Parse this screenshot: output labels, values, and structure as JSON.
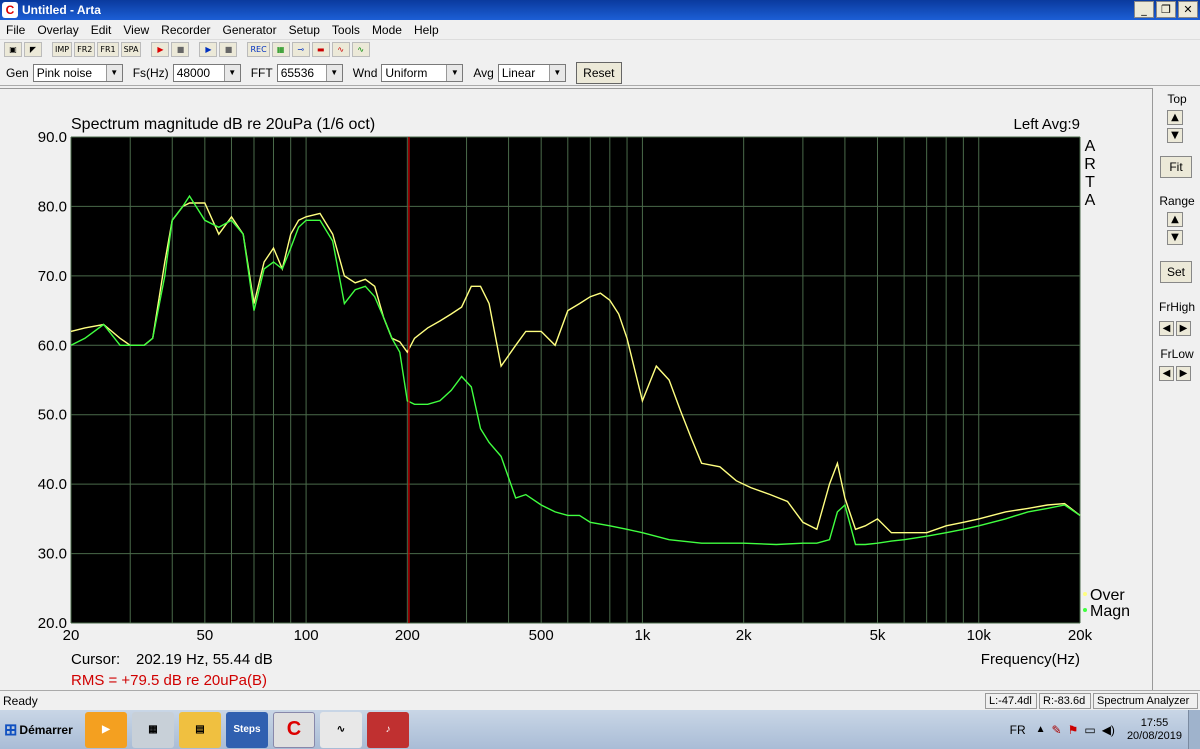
{
  "window": {
    "title": "Untitled - Arta",
    "icon": "arta-icon",
    "controls": [
      "_",
      "❐",
      "✕"
    ]
  },
  "menu": [
    "File",
    "Overlay",
    "Edit",
    "View",
    "Recorder",
    "Generator",
    "Setup",
    "Tools",
    "Mode",
    "Help"
  ],
  "toolbar": {
    "buttons": [
      {
        "name": "open-icon",
        "glyph": "▣"
      },
      {
        "name": "arrow-icon",
        "glyph": "◤"
      },
      {
        "name": "imp-button",
        "glyph": "IMP"
      },
      {
        "name": "fr2-button",
        "glyph": "FR2"
      },
      {
        "name": "fr1-button",
        "glyph": "FR1"
      },
      {
        "name": "spa-button",
        "glyph": "SPA"
      },
      {
        "name": "record-icon",
        "glyph": "▶"
      },
      {
        "name": "stop-icon",
        "glyph": "■"
      },
      {
        "name": "play-icon",
        "glyph": "▶"
      },
      {
        "name": "stop2-icon",
        "glyph": "■"
      },
      {
        "name": "rec-icon",
        "glyph": "REC"
      },
      {
        "name": "grid-icon",
        "glyph": "▦"
      },
      {
        "name": "probe-icon",
        "glyph": "⊸"
      },
      {
        "name": "colors-icon",
        "glyph": "▬"
      },
      {
        "name": "wave-icon",
        "glyph": "∿"
      },
      {
        "name": "scope-icon",
        "glyph": "∿"
      }
    ]
  },
  "generator_bar": {
    "gen_label": "Gen",
    "gen_value": "Pink noise",
    "fs_label": "Fs(Hz)",
    "fs_value": "48000",
    "fft_label": "FFT",
    "fft_value": "65536",
    "wnd_label": "Wnd",
    "wnd_value": "Uniform",
    "avg_label": "Avg",
    "avg_value": "Linear",
    "reset_label": "Reset"
  },
  "right_panel": {
    "top_label": "Top",
    "fit_label": "Fit",
    "range_label": "Range",
    "set_label": "Set",
    "frhigh_label": "FrHigh",
    "frlow_label": "FrLow"
  },
  "plot_info": {
    "cursor_label": "Cursor:",
    "cursor_value": "202.19 Hz, 55.44 dB",
    "rms_text": "RMS =  +79.5 dB re 20uPa(B)",
    "channel": "Left  Avg:9",
    "side_logo": [
      "A",
      "R",
      "T",
      "A"
    ]
  },
  "status": {
    "left": "Ready",
    "l_level": "L:-47.4dl",
    "r_level": "R:-83.6d",
    "mode": "Spectrum Analyzer"
  },
  "taskbar": {
    "start_label": "Démarrer",
    "apps": [
      {
        "name": "media-player-icon",
        "label": "",
        "bg": "#f4a020"
      },
      {
        "name": "calculator-icon",
        "label": "",
        "bg": "#c8d0d8"
      },
      {
        "name": "explorer-icon",
        "label": "",
        "bg": "#f0c040"
      },
      {
        "name": "steps-icon",
        "label": "Steps",
        "bg": "#3060b0"
      },
      {
        "name": "arta-task-icon",
        "label": "",
        "bg": "#e0e0e0"
      },
      {
        "name": "scope-task-icon",
        "label": "",
        "bg": "#e8e8e8"
      },
      {
        "name": "dj-icon",
        "label": "",
        "bg": "#c03030"
      }
    ],
    "lang": "FR",
    "time": "17:55",
    "date": "20/08/2019"
  },
  "colors": {
    "plot_bg": "#000000",
    "grid": "#4a6a4a",
    "overlay": "#ffff80",
    "magn": "#40ff40",
    "cursor": "#b00000",
    "rms": "#d00000"
  },
  "chart_data": {
    "type": "line",
    "title": "Spectrum magnitude dB re 20uPa (1/6 oct)",
    "xlabel": "Frequency(Hz)",
    "ylabel": "",
    "xscale": "log",
    "xlim": [
      20,
      20000
    ],
    "ylim": [
      20,
      90
    ],
    "x_ticks": [
      20,
      50,
      100,
      200,
      500,
      1000,
      2000,
      5000,
      10000,
      20000
    ],
    "x_tick_labels": [
      "20",
      "50",
      "100",
      "200",
      "500",
      "1k",
      "2k",
      "5k",
      "10k",
      "20k"
    ],
    "y_ticks": [
      20,
      30,
      40,
      50,
      60,
      70,
      80,
      90
    ],
    "y_tick_labels": [
      "20.0",
      "30.0",
      "40.0",
      "50.0",
      "60.0",
      "70.0",
      "80.0",
      "90.0"
    ],
    "cursor_x": 202.19,
    "legend": "bottom-right",
    "series": [
      {
        "name": "Over",
        "x": [
          20,
          22,
          25,
          28,
          30,
          33,
          35,
          38,
          40,
          43,
          45,
          50,
          55,
          60,
          65,
          70,
          75,
          80,
          85,
          90,
          95,
          100,
          110,
          120,
          130,
          140,
          150,
          160,
          170,
          180,
          190,
          200,
          210,
          230,
          250,
          270,
          290,
          310,
          330,
          350,
          380,
          420,
          450,
          500,
          550,
          600,
          650,
          700,
          750,
          800,
          850,
          900,
          1000,
          1100,
          1200,
          1300,
          1400,
          1500,
          1700,
          1900,
          2100,
          2400,
          2700,
          3000,
          3300,
          3600,
          3800,
          4000,
          4300,
          4600,
          5000,
          5500,
          6000,
          7000,
          8000,
          9000,
          10000,
          12000,
          14000,
          16000,
          18000,
          20000
        ],
        "y": [
          62,
          62.5,
          63,
          61,
          60,
          60,
          61,
          72,
          78,
          80,
          80.5,
          80.5,
          76,
          78.5,
          76,
          66,
          72,
          74,
          71,
          76,
          78,
          78.5,
          79,
          76,
          70,
          69,
          69.5,
          68.5,
          64,
          61,
          60.5,
          59,
          61,
          62.5,
          63.5,
          64.5,
          65.5,
          68.5,
          68.5,
          66,
          57,
          60,
          62,
          62,
          60,
          65,
          66,
          67,
          67.5,
          66.5,
          64.5,
          61,
          52,
          57,
          55,
          50.5,
          46.5,
          43,
          42.5,
          40.5,
          39.5,
          38.5,
          37.5,
          34.5,
          33.5,
          40,
          43,
          38,
          33.5,
          34,
          35,
          33,
          33,
          33,
          34,
          34.5,
          35,
          36,
          36.5,
          37,
          37.2,
          35.5
        ]
      },
      {
        "name": "Magn",
        "x": [
          20,
          22,
          25,
          28,
          30,
          33,
          35,
          38,
          40,
          43,
          45,
          50,
          55,
          60,
          65,
          70,
          75,
          80,
          85,
          90,
          95,
          100,
          110,
          120,
          130,
          140,
          150,
          160,
          170,
          180,
          190,
          200,
          210,
          230,
          250,
          270,
          290,
          310,
          330,
          350,
          380,
          420,
          450,
          500,
          550,
          600,
          650,
          700,
          800,
          900,
          1000,
          1200,
          1500,
          2000,
          2500,
          3000,
          3300,
          3600,
          3800,
          4000,
          4300,
          4600,
          5000,
          5500,
          6000,
          7000,
          8000,
          9000,
          10000,
          12000,
          14000,
          16000,
          18000,
          20000
        ],
        "y": [
          60,
          61,
          63,
          60,
          60,
          60,
          61,
          70,
          78,
          80,
          81.5,
          78,
          77,
          78,
          76,
          65,
          71,
          72,
          71,
          74,
          77,
          78,
          78,
          75,
          66,
          68,
          68.5,
          67,
          64,
          61,
          59,
          52,
          51.5,
          51.5,
          52,
          53.5,
          55.5,
          54,
          48,
          46,
          44,
          38,
          38.5,
          37,
          36,
          35.5,
          35.5,
          34.5,
          34,
          33.5,
          33,
          32,
          31.5,
          31.5,
          31.3,
          31.5,
          31.5,
          32,
          36,
          37,
          31.3,
          31.3,
          31.5,
          31.8,
          32,
          32.5,
          33,
          33.5,
          34,
          35,
          36,
          36.5,
          37,
          35.5
        ]
      }
    ]
  }
}
